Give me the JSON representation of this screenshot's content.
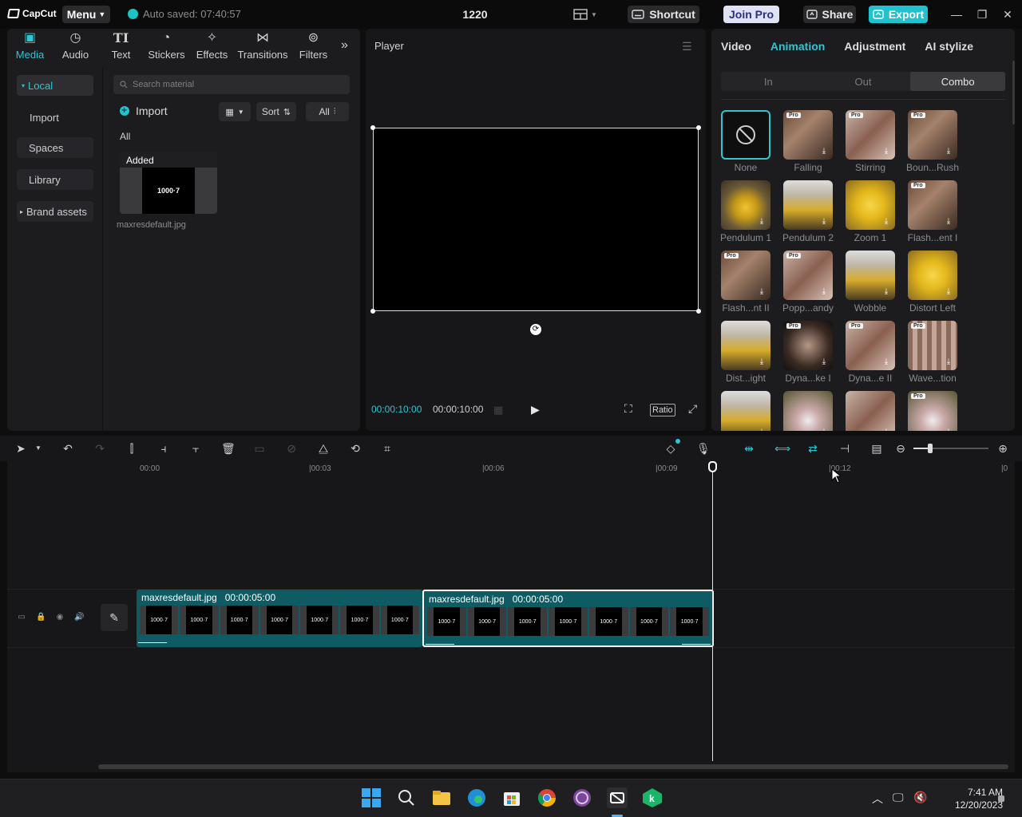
{
  "titlebar": {
    "app_name": "CapCut",
    "menu_label": "Menu",
    "autosave": "Auto saved: 07:40:57",
    "project_title": "1220",
    "shortcut_label": "Shortcut",
    "join_pro_label": "Join Pro",
    "share_label": "Share",
    "export_label": "Export"
  },
  "media_tabs": [
    {
      "label": "Media",
      "icon": "media-icon"
    },
    {
      "label": "Audio",
      "icon": "audio-icon"
    },
    {
      "label": "Text",
      "icon": "text-icon"
    },
    {
      "label": "Stickers",
      "icon": "sticker-icon"
    },
    {
      "label": "Effects",
      "icon": "effects-icon"
    },
    {
      "label": "Transitions",
      "icon": "transitions-icon"
    },
    {
      "label": "Filters",
      "icon": "filters-icon"
    }
  ],
  "sidenav": {
    "local": "Local",
    "import": "Import",
    "spaces": "Spaces",
    "library": "Library",
    "brand_assets": "Brand assets"
  },
  "media": {
    "search_placeholder": "Search material",
    "import_label": "Import",
    "sort_label": "Sort",
    "all_filter": "All",
    "section_label": "All",
    "item": {
      "badge": "Added",
      "preview_text": "1000·7",
      "name": "maxresdefault.jpg"
    }
  },
  "player": {
    "title": "Player",
    "current_time": "00:00:10:00",
    "total_time": "00:00:10:00",
    "ratio_label": "Ratio"
  },
  "right_panel": {
    "tabs": [
      "Video",
      "Animation",
      "Adjustment",
      "AI stylize"
    ],
    "active_tab": "Animation",
    "subtabs": [
      "In",
      "Out",
      "Combo"
    ],
    "active_subtab": "Combo",
    "pro_badge": "Pro",
    "animations": [
      {
        "label": "None",
        "style": "none",
        "pro": false
      },
      {
        "label": "Falling",
        "style": "person",
        "pro": true
      },
      {
        "label": "Stirring",
        "style": "pop",
        "pro": true
      },
      {
        "label": "Boun...Rush",
        "style": "person",
        "pro": true
      },
      {
        "label": "Pendulum 1",
        "style": "leaf",
        "pro": false
      },
      {
        "label": "Pendulum 2",
        "style": "forest",
        "pro": false
      },
      {
        "label": "Zoom 1",
        "style": "zoom",
        "pro": false
      },
      {
        "label": "Flash...ent I",
        "style": "person",
        "pro": true
      },
      {
        "label": "Flash...nt II",
        "style": "person",
        "pro": true
      },
      {
        "label": "Popp...andy",
        "style": "pop",
        "pro": true
      },
      {
        "label": "Wobble",
        "style": "forest",
        "pro": false
      },
      {
        "label": "Distort Left",
        "style": "zoom",
        "pro": false
      },
      {
        "label": "Dist...ight",
        "style": "forest",
        "pro": false
      },
      {
        "label": "Dyna...ke I",
        "style": "dyn",
        "pro": true
      },
      {
        "label": "Dyna...e II",
        "style": "pop",
        "pro": true
      },
      {
        "label": "Wave...tion",
        "style": "wave",
        "pro": true
      },
      {
        "label": "",
        "style": "forest",
        "pro": false
      },
      {
        "label": "",
        "style": "rays",
        "pro": false
      },
      {
        "label": "",
        "style": "pop",
        "pro": false
      },
      {
        "label": "",
        "style": "rays",
        "pro": true
      }
    ]
  },
  "timeline": {
    "ruler": [
      "00:00",
      "|00:03",
      "|00:06",
      "|00:09",
      "|00:12",
      "|0"
    ],
    "clips": [
      {
        "name": "maxresdefault.jpg",
        "duration": "00:00:05:00",
        "selected": false
      },
      {
        "name": "maxresdefault.jpg",
        "duration": "00:00:05:00",
        "selected": true
      }
    ],
    "frame_text": "1000·7"
  },
  "taskbar": {
    "time": "7:41 AM",
    "date": "12/20/2023"
  },
  "colors": {
    "accent": "#2fc5d2",
    "clip": "#0f5b63",
    "panel": "#1c1c1e"
  }
}
